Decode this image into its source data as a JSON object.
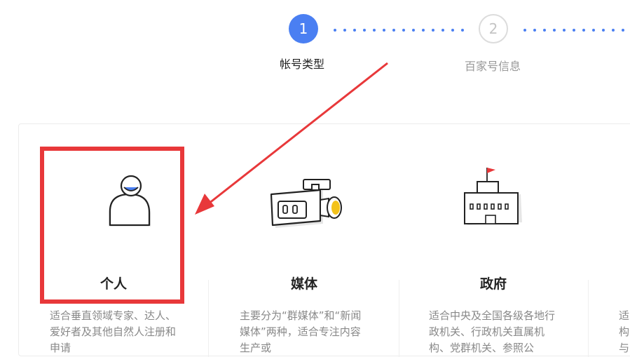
{
  "steps": [
    {
      "number": "1",
      "label": "帐号类型"
    },
    {
      "number": "2",
      "label": "百家号信息"
    }
  ],
  "cards": [
    {
      "title": "个人",
      "desc": "适合垂直领域专家、达人、爱好者及其他自然人注册和申请",
      "icon": "person-icon"
    },
    {
      "title": "媒体",
      "desc": "主要分为“群媒体”和“新闻媒体”两种，适合专注内容生产或",
      "icon": "video-camera-icon"
    },
    {
      "title": "政府",
      "desc": "适合中央及全国各级各地行政机关、行政机关直属机构、党群机关、参照公",
      "icon": "government-building-icon"
    },
    {
      "title": "",
      "desc": "适构与",
      "icon": ""
    }
  ],
  "colors": {
    "accent": "#4a7ff2",
    "highlight": "#e8383a",
    "camera_lens": "#f3c21b",
    "flag": "#e8383a"
  }
}
